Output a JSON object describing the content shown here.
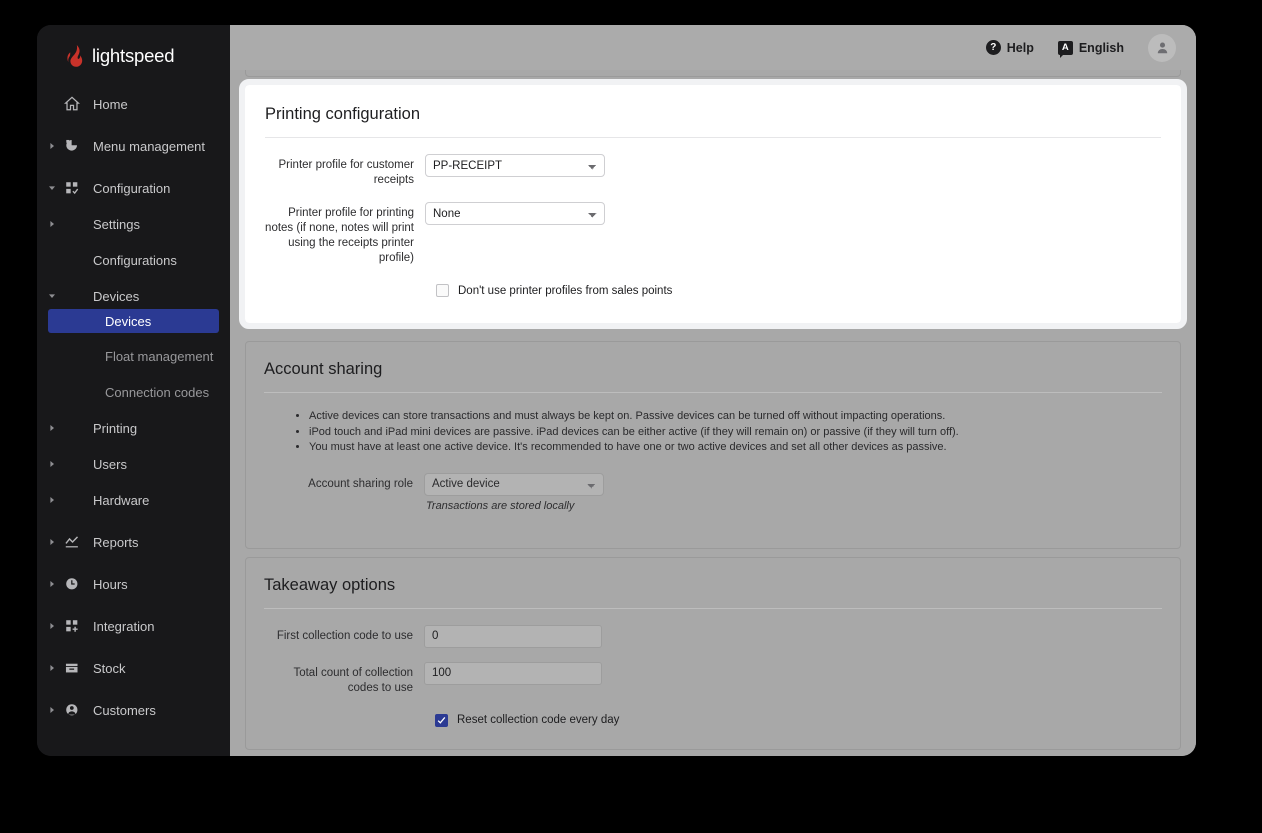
{
  "brand": {
    "name": "lightspeed"
  },
  "topbar": {
    "help_label": "Help",
    "help_icon_char": "?",
    "language_label": "English",
    "language_icon_char": "A",
    "avatar_icon": "user-icon"
  },
  "sidebar": {
    "items": [
      {
        "label": "Home",
        "icon": "home-icon",
        "level": 1,
        "caret": false,
        "selected": false
      },
      {
        "label": "Menu management",
        "icon": "pie-chart-icon",
        "level": 1,
        "caret": "collapsed",
        "selected": false
      },
      {
        "label": "Configuration",
        "icon": "grid-check-icon",
        "level": 1,
        "caret": "expanded",
        "selected": false
      },
      {
        "label": "Settings",
        "icon": null,
        "level": 2,
        "caret": "collapsed",
        "selected": false
      },
      {
        "label": "Configurations",
        "icon": null,
        "level": 2,
        "caret": false,
        "selected": false
      },
      {
        "label": "Devices",
        "icon": null,
        "level": 2,
        "caret": "expanded",
        "selected": false
      },
      {
        "label": "Devices",
        "icon": null,
        "level": 3,
        "caret": false,
        "selected": true
      },
      {
        "label": "Float management",
        "icon": null,
        "level": 3,
        "caret": false,
        "selected": false
      },
      {
        "label": "Connection codes",
        "icon": null,
        "level": 3,
        "caret": false,
        "selected": false
      },
      {
        "label": "Printing",
        "icon": null,
        "level": 2,
        "caret": "collapsed",
        "selected": false
      },
      {
        "label": "Users",
        "icon": null,
        "level": 2,
        "caret": "collapsed",
        "selected": false
      },
      {
        "label": "Hardware",
        "icon": null,
        "level": 2,
        "caret": "collapsed",
        "selected": false
      },
      {
        "label": "Reports",
        "icon": "chart-line-icon",
        "level": 1,
        "caret": "collapsed",
        "selected": false
      },
      {
        "label": "Hours",
        "icon": "clock-icon",
        "level": 1,
        "caret": "collapsed",
        "selected": false
      },
      {
        "label": "Integration",
        "icon": "grid-plus-icon",
        "level": 1,
        "caret": "collapsed",
        "selected": false
      },
      {
        "label": "Stock",
        "icon": "box-icon",
        "level": 1,
        "caret": "collapsed",
        "selected": false
      },
      {
        "label": "Customers",
        "icon": "person-circle-icon",
        "level": 1,
        "caret": "collapsed",
        "selected": false
      }
    ]
  },
  "printing_configuration": {
    "title": "Printing configuration",
    "receipt_profile_label": "Printer profile for customer receipts",
    "receipt_profile_value": "PP-RECEIPT",
    "notes_profile_label": "Printer profile for printing notes (if none, notes will print using the receipts printer profile)",
    "notes_profile_value": "None",
    "no_sales_point_profiles_label": "Don't use printer profiles from sales points",
    "no_sales_point_profiles_checked": false
  },
  "account_sharing": {
    "title": "Account sharing",
    "bullets": [
      "Active devices can store transactions and must always be kept on. Passive devices can be turned off without impacting operations.",
      "iPod touch and iPad mini devices are passive. iPad devices can be either active (if they will remain on) or passive (if they will turn off).",
      "You must have at least one active device. It's recommended to have one or two active devices and set all other devices as passive."
    ],
    "role_label": "Account sharing role",
    "role_value": "Active device",
    "role_helper": "Transactions are stored locally"
  },
  "takeaway_options": {
    "title": "Takeaway options",
    "first_code_label": "First collection code to use",
    "first_code_value": "0",
    "total_count_label": "Total count of collection codes to use",
    "total_count_value": "100",
    "reset_label": "Reset collection code every day",
    "reset_checked": true
  },
  "colors": {
    "accent": "#2b3a93",
    "brand_red": "#c8322a",
    "sidebar_bg": "#18181a",
    "page_bg": "#a8a8a8"
  }
}
